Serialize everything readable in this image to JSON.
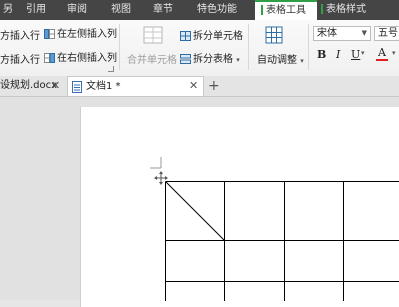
{
  "menu": {
    "tabs": [
      {
        "label": "另"
      },
      {
        "label": "引用"
      },
      {
        "label": "审阅"
      },
      {
        "label": "视图"
      },
      {
        "label": "章节"
      },
      {
        "label": "特色功能"
      },
      {
        "label": "表格工具"
      },
      {
        "label": "表格样式"
      }
    ],
    "active_tab": "表格工具"
  },
  "ribbon": {
    "insert_row_above": "方插入行",
    "insert_row_below": "方插入行",
    "insert_col_left": "在左侧插入列",
    "insert_col_right": "在右侧插入列",
    "merge_cells": "合并单元格",
    "split_cells": "拆分单元格",
    "split_table": "拆分表格",
    "auto_fit": "自动调整",
    "font_name": "宋体",
    "font_size": "五号",
    "bold": "B",
    "italic": "I",
    "underline": "U",
    "font_color": "A"
  },
  "doc_tabs": [
    {
      "title": "设规划.docx"
    },
    {
      "title": "文档1 *"
    }
  ],
  "new_tab": "+",
  "colors": {
    "accent": "#2f9e44",
    "menubar": "#454545",
    "table_line": "#000000"
  }
}
